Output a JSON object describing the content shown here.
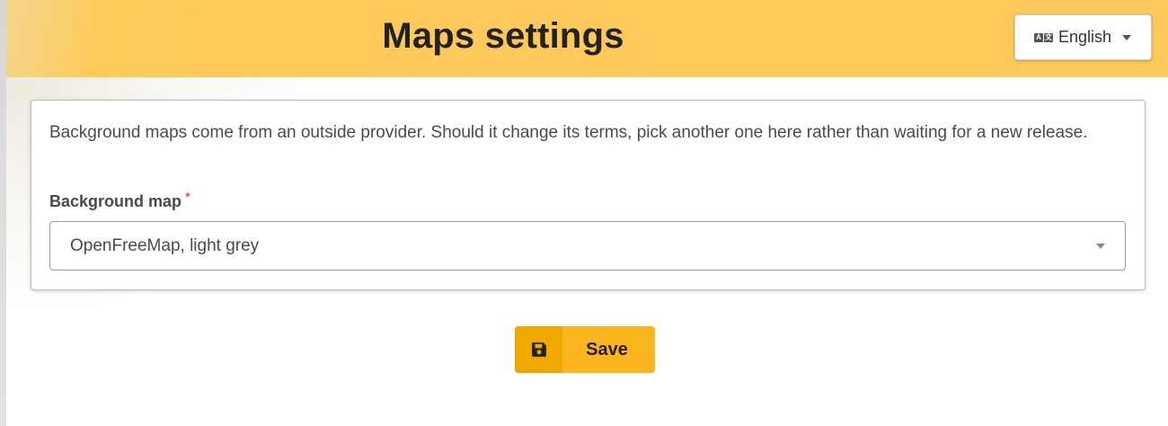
{
  "header": {
    "title": "Maps settings",
    "language": {
      "label": "English",
      "icon": "translate-icon",
      "icon_glyphs": [
        "A",
        "文"
      ]
    }
  },
  "settings": {
    "description": "Background maps come from an outside provider. Should it change its terms, pick another one here rather than waiting for a new release.",
    "background_map": {
      "label": "Background map",
      "required_mark": "*",
      "selected": "OpenFreeMap, light grey"
    }
  },
  "actions": {
    "save_label": "Save",
    "save_icon": "floppy-disk-icon"
  },
  "colors": {
    "header_bg": "#fec95a",
    "save_button": "#fcb51f",
    "save_icon_bg": "#f0a800",
    "required": "#d62b2b"
  }
}
